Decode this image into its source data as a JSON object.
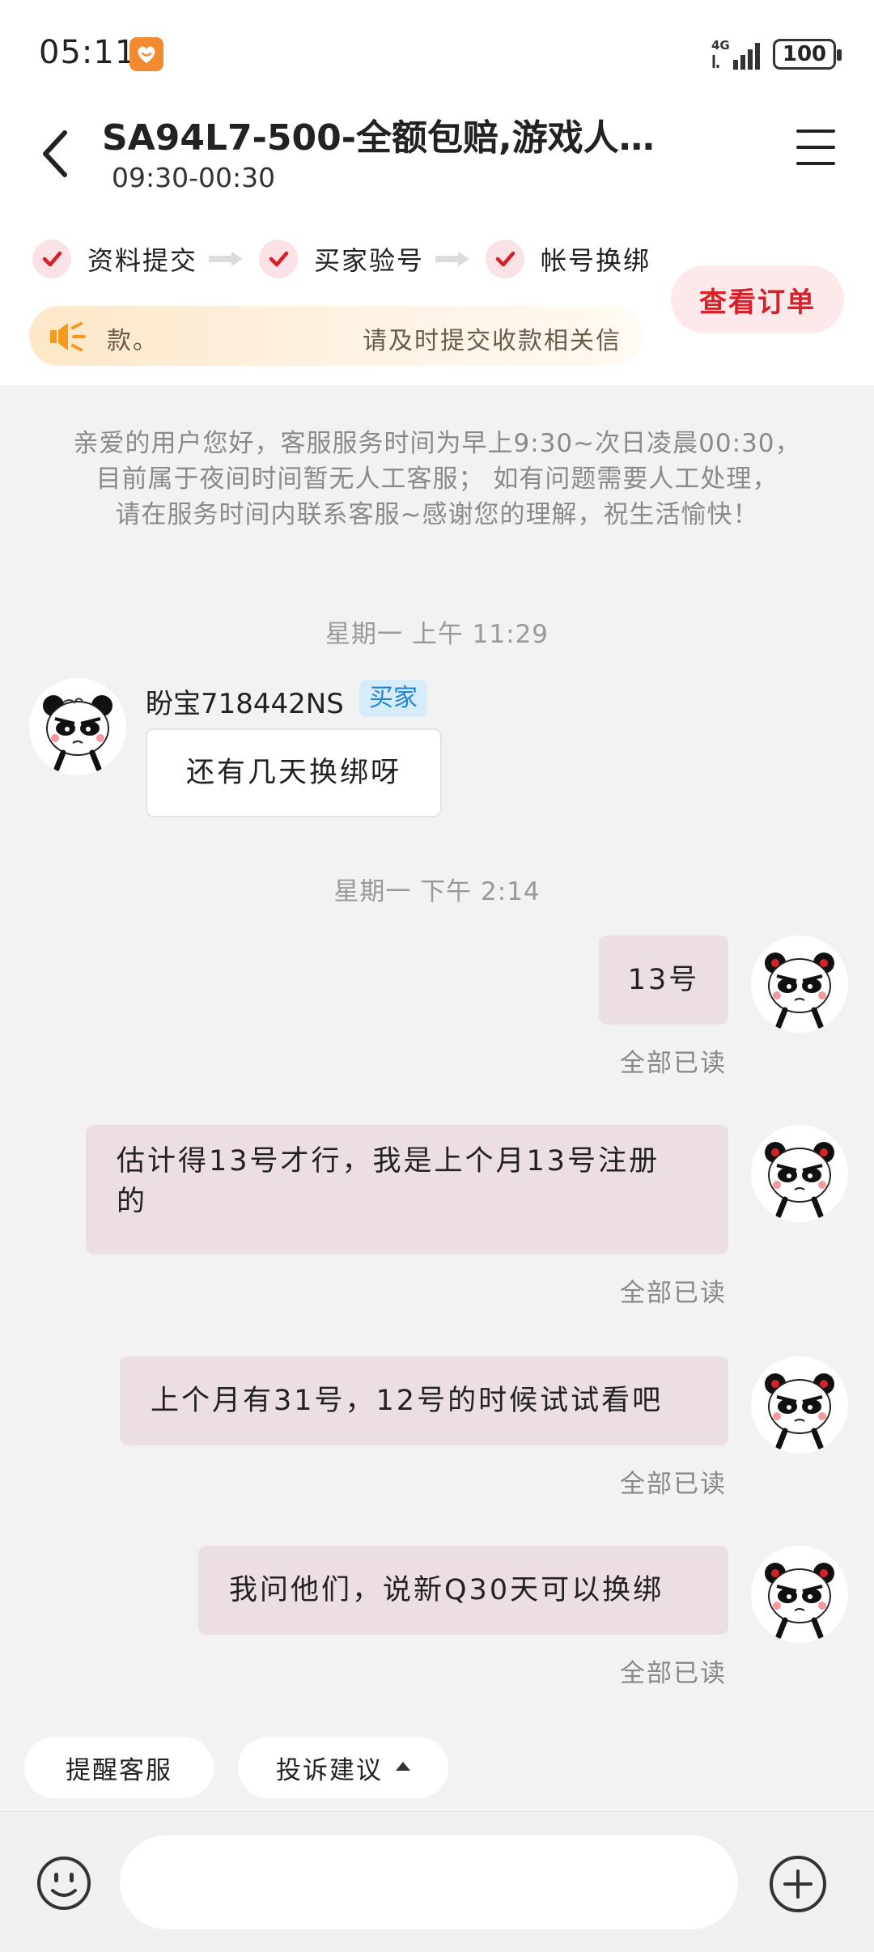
{
  "status_bar": {
    "time": "05:11",
    "network": "4G",
    "battery": "100"
  },
  "header": {
    "title": "SA94L7-500-全额包赔,游戏人…",
    "subtitle": "09:30-00:30"
  },
  "steps": [
    {
      "label": "资料提交"
    },
    {
      "label": "买家验号"
    },
    {
      "label": "帐号换绑"
    }
  ],
  "view_order_label": "查看订单",
  "notice": {
    "text_a": "款。",
    "text_b": "请及时提交收款相关信"
  },
  "system_notice": {
    "line1": "亲爱的用户您好，客服服务时间为早上9:30~次日凌晨00:30，",
    "line2": "目前属于夜间时间暂无人工客服；  如有问题需要人工处理，",
    "line3": "请在服务时间内联系客服~感谢您的理解，祝生活愉快！"
  },
  "timestamps": {
    "t1": "星期一 上午 11:29",
    "t2": "星期一 下午 2:14"
  },
  "incoming": {
    "sender": "盼宝718442NS",
    "tag": "买家",
    "text": "还有几天换绑呀"
  },
  "outgoing": [
    {
      "text": "13号",
      "status": "全部已读"
    },
    {
      "text_line1": "估计得13号才行，我是上个月13号注册",
      "text_line2": "的",
      "status": "全部已读"
    },
    {
      "text": "上个月有31号，12号的时候试试看吧",
      "status": "全部已读"
    },
    {
      "text": "我问他们，说新Q30天可以换绑",
      "status": "全部已读"
    }
  ],
  "quick_actions": {
    "remind": "提醒客服",
    "complaint": "投诉建议"
  },
  "input": {
    "placeholder": ""
  },
  "colors": {
    "accent": "#d8202b",
    "bubble_out": "#ecdfe1",
    "tag_bg": "#d7ecfb",
    "tag_text": "#2286d8"
  }
}
